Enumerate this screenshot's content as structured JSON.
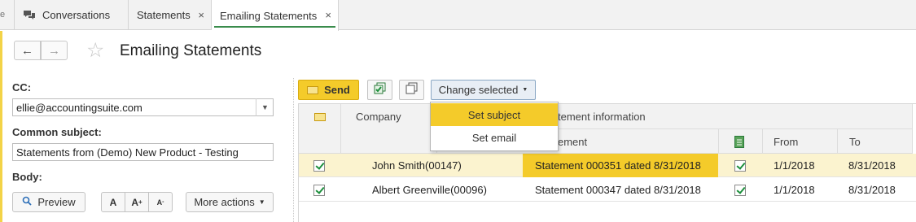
{
  "tabs": [
    {
      "label": "Conversations"
    },
    {
      "label": "Statements",
      "close": "×"
    },
    {
      "label": "Emailing Statements",
      "close": "×"
    }
  ],
  "header": {
    "title": "Emailing Statements",
    "back": "←",
    "forward": "→",
    "star": "☆"
  },
  "form": {
    "cc_label": "CC:",
    "cc_value": "ellie@accountingsuite.com",
    "subject_label": "Common subject:",
    "subject_value": "Statements from (Demo) New Product - Testing",
    "body_label": "Body:",
    "preview_label": "Preview",
    "more_actions_label": "More actions",
    "font_btn_1": "A",
    "font_btn_2": "A",
    "font_btn_3": "A"
  },
  "toolbar": {
    "send_label": "Send",
    "change_selected_label": "Change selected"
  },
  "popup_menu": {
    "items": [
      {
        "label": "Set subject"
      },
      {
        "label": "Set email"
      }
    ]
  },
  "table": {
    "headers": {
      "company": "Company",
      "statement_group": "tement information",
      "statement": "ement",
      "from": "From",
      "to": "To"
    },
    "rows": [
      {
        "company": "John Smith(00147)",
        "statement": "Statement 000351 dated 8/31/2018",
        "from": "1/1/2018",
        "to": "8/31/2018"
      },
      {
        "company": "Albert Greenville(00096)",
        "statement": "Statement 000347 dated 8/31/2018",
        "from": "1/1/2018",
        "to": "8/31/2018"
      }
    ]
  },
  "colors": {
    "accent": "#f4cb2a",
    "active_tab_underline": "#3a8c4c",
    "check_green": "#1c8f3c"
  }
}
